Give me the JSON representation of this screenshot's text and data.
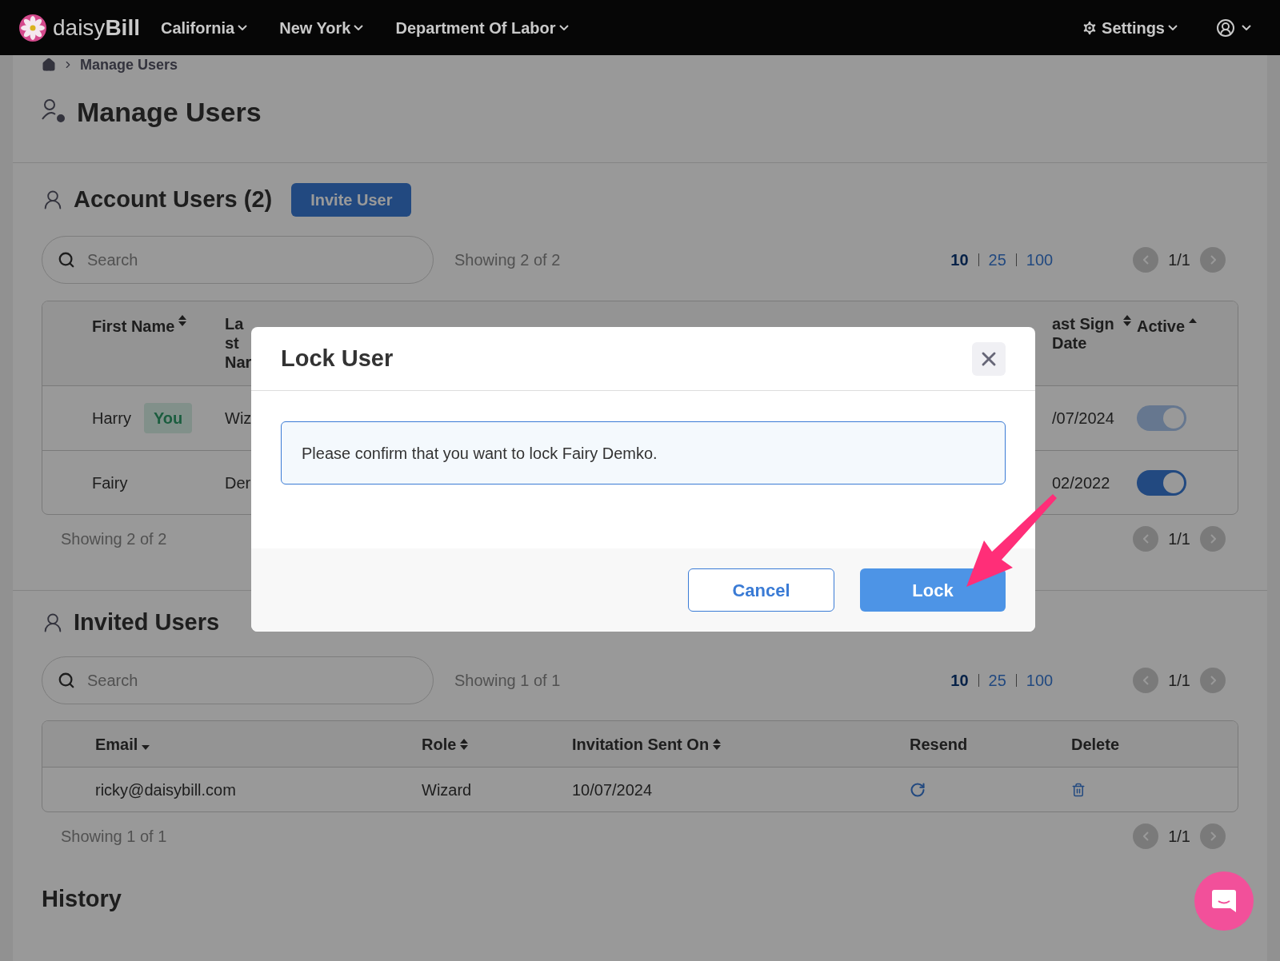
{
  "navbar": {
    "brand_plain": "daisy",
    "brand_bold": "Bill",
    "menus": [
      "California",
      "New York",
      "Department Of Labor"
    ],
    "settings": "Settings"
  },
  "breadcrumb": {
    "current": "Manage Users"
  },
  "page_title": "Manage Users",
  "account_users": {
    "title": "Account Users (2)",
    "invite_button": "Invite User",
    "search": {
      "placeholder": "Search"
    },
    "showing_top": "Showing 2 of 2",
    "page_sizes": [
      {
        "label": "10",
        "selected": true
      },
      {
        "label": "25",
        "selected": false
      },
      {
        "label": "100",
        "selected": false
      }
    ],
    "page_top": "1/1",
    "columns": [
      {
        "label": "First Name",
        "kind": "sortable"
      },
      {
        "label": "Last Nar",
        "kind": "plain"
      },
      {
        "label": "ast Sign Date",
        "kind": "sortable"
      },
      {
        "label": "Active",
        "kind": "ascending"
      }
    ],
    "rows": [
      {
        "first_name": "Harry",
        "badge": "You",
        "last_name": "Wiz",
        "last_sign_in": "/07/2024",
        "active": {
          "on": true,
          "disabled": true
        }
      },
      {
        "first_name": "Fairy",
        "last_name": "Der",
        "last_sign_in": "02/2022",
        "active": {
          "on": true,
          "disabled": false
        }
      }
    ],
    "showing_bottom": "Showing 2 of 2",
    "page_bottom": "1/1"
  },
  "invited_users": {
    "title": "Invited Users",
    "search": {
      "placeholder": "Search"
    },
    "showing_top": "Showing 1 of 1",
    "page_sizes": [
      {
        "label": "10",
        "selected": true
      },
      {
        "label": "25",
        "selected": false
      },
      {
        "label": "100",
        "selected": false
      }
    ],
    "page_top": "1/1",
    "columns": [
      {
        "label": "Email",
        "kind": "descending"
      },
      {
        "label": "Role",
        "kind": "sortable"
      },
      {
        "label": "Invitation Sent On",
        "kind": "sortable"
      },
      {
        "label": "Resend",
        "kind": "plain"
      },
      {
        "label": "Delete",
        "kind": "plain"
      }
    ],
    "rows": [
      {
        "email": "ricky@daisybill.com",
        "role": "Wizard",
        "sent_on": "10/07/2024"
      }
    ],
    "showing_bottom": "Showing 1 of 1",
    "page_bottom": "1/1"
  },
  "history": {
    "title": "History"
  },
  "modal": {
    "title": "Lock User",
    "message": "Please confirm that you want to lock Fairy Demko.",
    "cancel_button": "Cancel",
    "lock_button": "Lock"
  }
}
